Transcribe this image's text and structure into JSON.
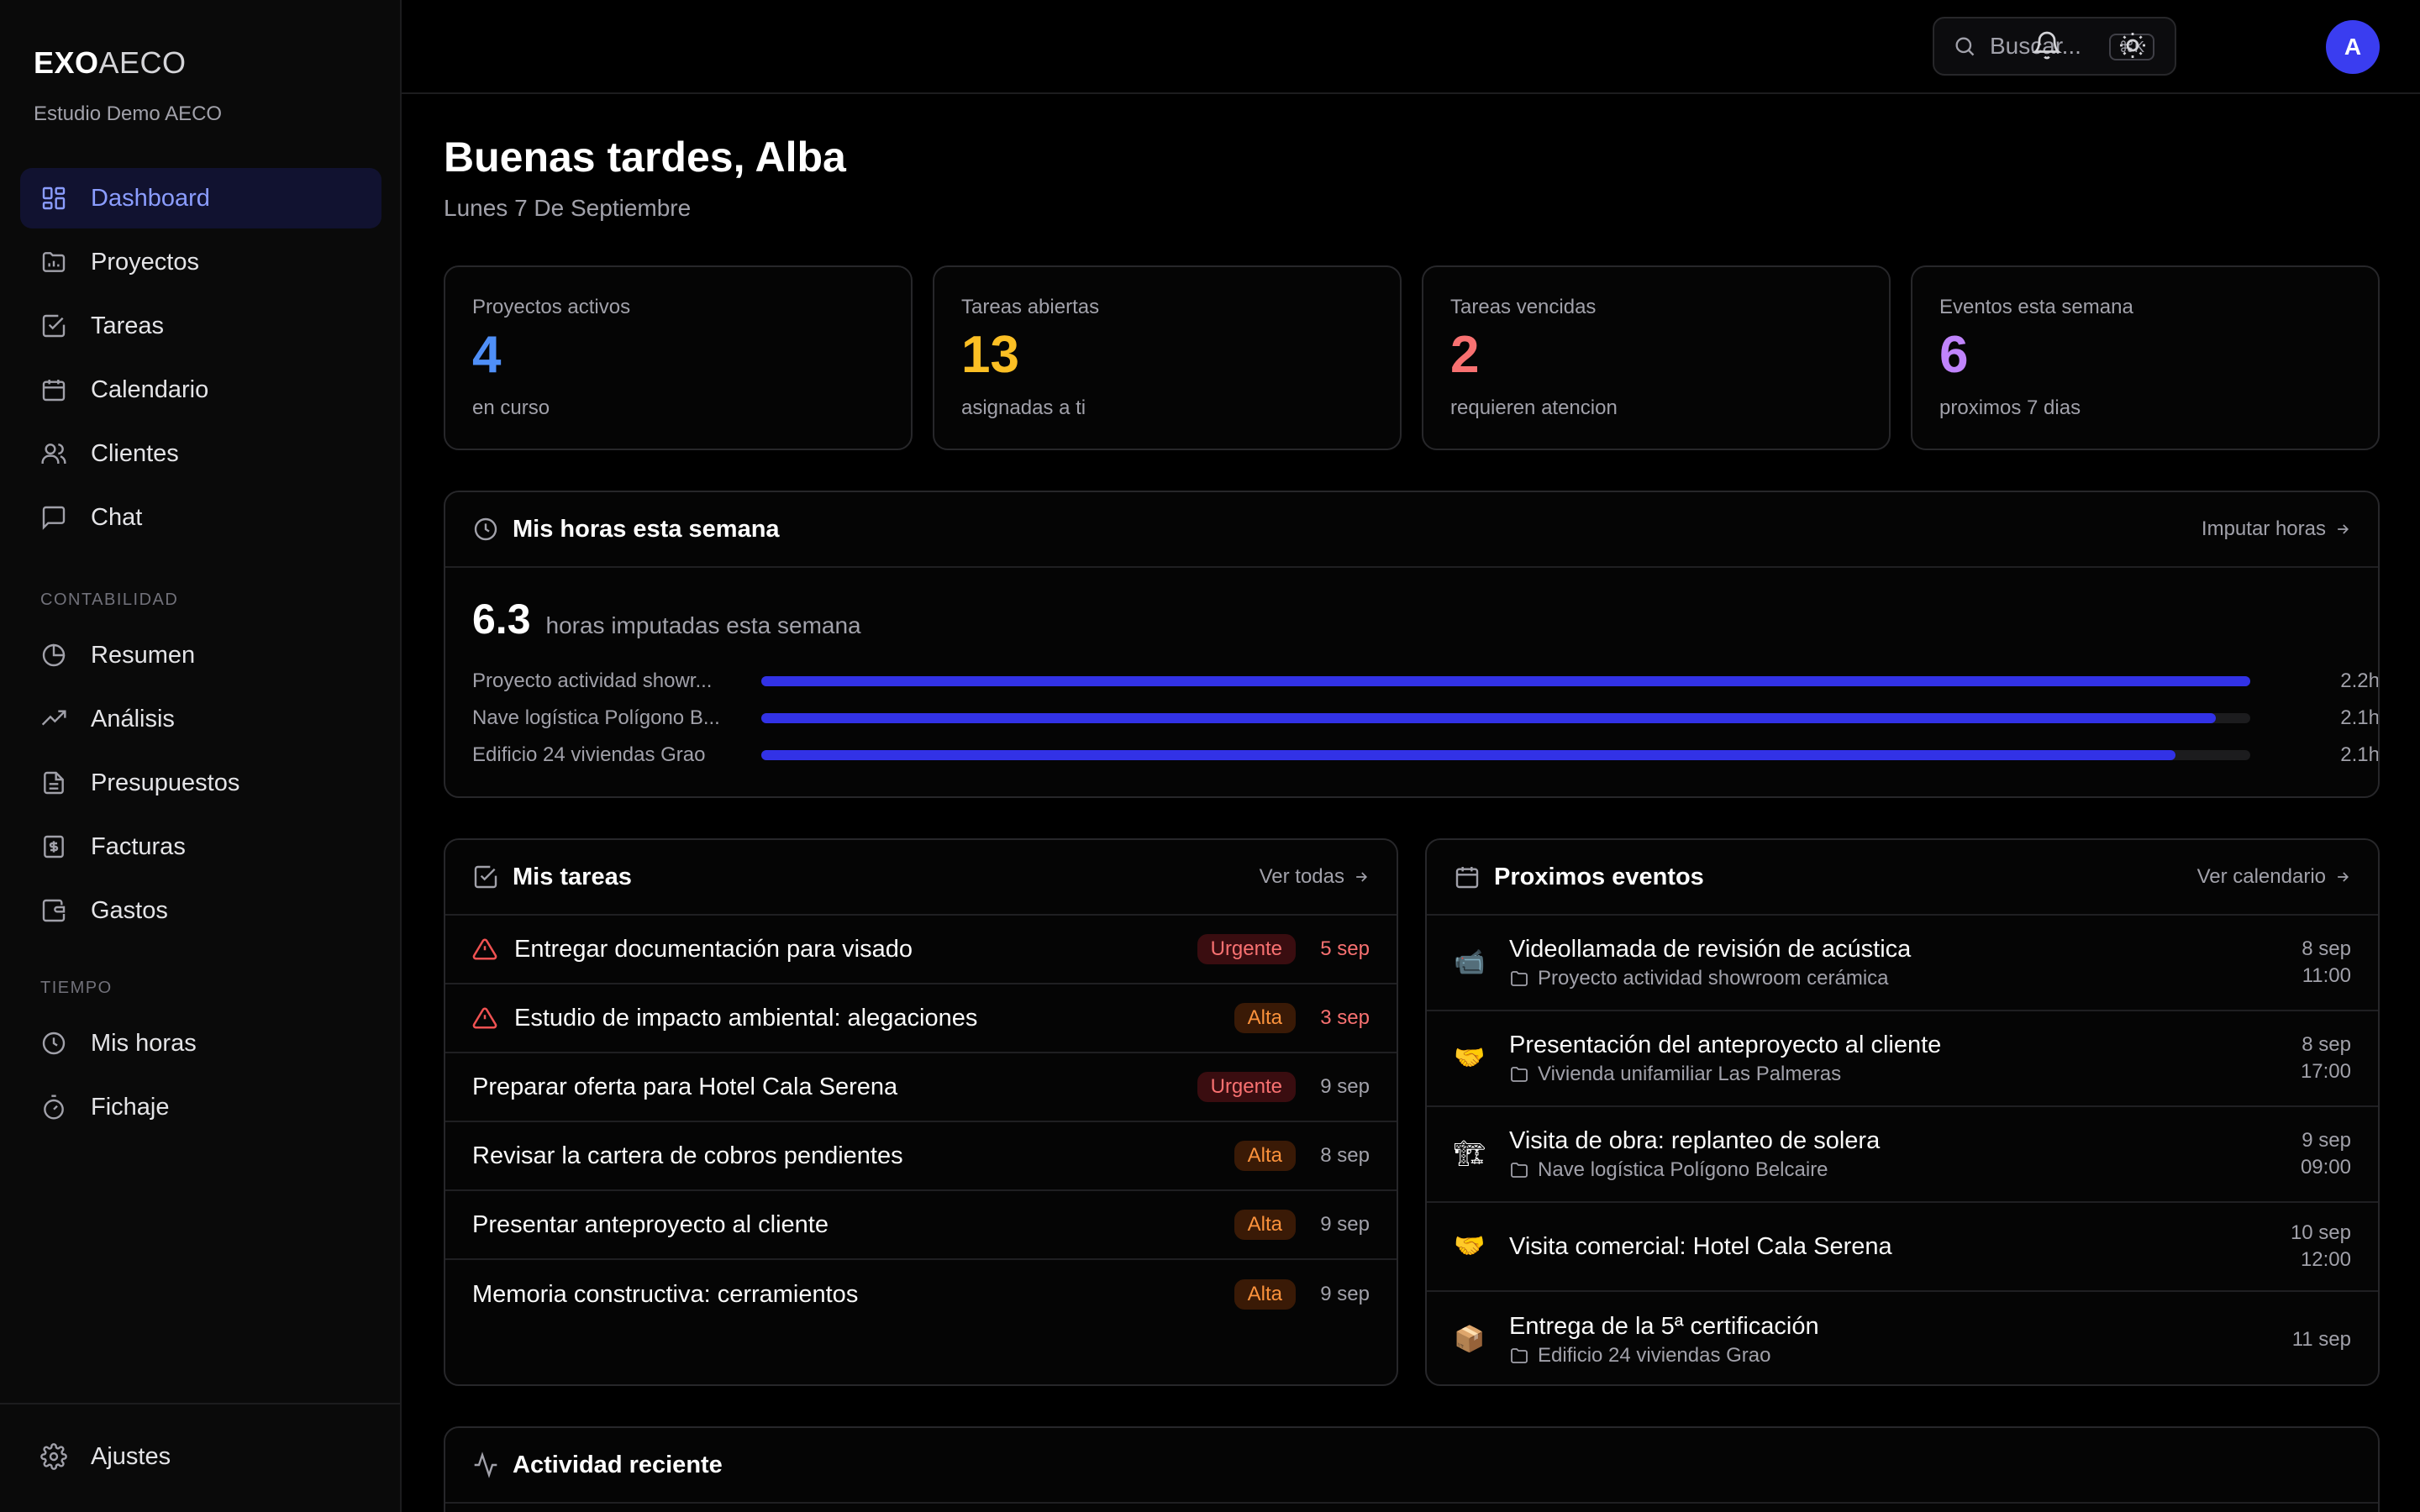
{
  "brand": {
    "bold": "EXO",
    "light": "AECO",
    "org": "Estudio Demo AECO"
  },
  "sidebar": {
    "main_items": [
      {
        "label": "Dashboard",
        "icon": "grid-icon",
        "active": true
      },
      {
        "label": "Proyectos",
        "icon": "folder-icon"
      },
      {
        "label": "Tareas",
        "icon": "checkbox-icon"
      },
      {
        "label": "Calendario",
        "icon": "calendar-icon"
      },
      {
        "label": "Clientes",
        "icon": "users-icon"
      },
      {
        "label": "Chat",
        "icon": "chat-icon"
      }
    ],
    "contabilidad_label": "CONTABILIDAD",
    "contabilidad_items": [
      {
        "label": "Resumen",
        "icon": "pie-chart-icon"
      },
      {
        "label": "Análisis",
        "icon": "trending-icon"
      },
      {
        "label": "Presupuestos",
        "icon": "document-icon"
      },
      {
        "label": "Facturas",
        "icon": "invoice-icon"
      },
      {
        "label": "Gastos",
        "icon": "wallet-icon"
      }
    ],
    "tiempo_label": "TIEMPO",
    "tiempo_items": [
      {
        "label": "Mis horas",
        "icon": "clock-icon"
      },
      {
        "label": "Fichaje",
        "icon": "timer-icon"
      }
    ],
    "settings_label": "Ajustes"
  },
  "topbar": {
    "search_placeholder": "Buscar...",
    "shortcut": "⌘K",
    "avatar_initial": "A"
  },
  "header": {
    "greeting": "Buenas tardes, Alba",
    "date": "Lunes 7 De Septiembre"
  },
  "stats": [
    {
      "label": "Proyectos activos",
      "value": "4",
      "sub": "en curso",
      "color": "#4f8ff7"
    },
    {
      "label": "Tareas abiertas",
      "value": "13",
      "sub": "asignadas a ti",
      "color": "#fbbf24"
    },
    {
      "label": "Tareas vencidas",
      "value": "2",
      "sub": "requieren atencion",
      "color": "#f87171"
    },
    {
      "label": "Eventos esta semana",
      "value": "6",
      "sub": "proximos 7 dias",
      "color": "#c084fc"
    }
  ],
  "hours": {
    "title": "Mis horas esta semana",
    "link": "Imputar horas",
    "total": "6.3",
    "total_label": "horas imputadas esta semana",
    "rows": [
      {
        "project": "Proyecto actividad showr...",
        "hours": "2.2h",
        "fraction": 1.0
      },
      {
        "project": "Nave logística Polígono B...",
        "hours": "2.1h",
        "fraction": 0.977
      },
      {
        "project": "Edificio 24 viviendas Grao",
        "hours": "2.1h",
        "fraction": 0.95
      }
    ]
  },
  "tasks": {
    "title": "Mis tareas",
    "link": "Ver todas",
    "items": [
      {
        "name": "Entregar documentación para visado",
        "priority": "Urgente",
        "due": "5 sep",
        "overdue": true
      },
      {
        "name": "Estudio de impacto ambiental: alegaciones",
        "priority": "Alta",
        "due": "3 sep",
        "overdue": true
      },
      {
        "name": "Preparar oferta para Hotel Cala Serena",
        "priority": "Urgente",
        "due": "9 sep",
        "overdue": false
      },
      {
        "name": "Revisar la cartera de cobros pendientes",
        "priority": "Alta",
        "due": "8 sep",
        "overdue": false
      },
      {
        "name": "Presentar anteproyecto al cliente",
        "priority": "Alta",
        "due": "9 sep",
        "overdue": false
      },
      {
        "name": "Memoria constructiva: cerramientos",
        "priority": "Alta",
        "due": "9 sep",
        "overdue": false
      }
    ]
  },
  "events": {
    "title": "Proximos eventos",
    "link": "Ver calendario",
    "items": [
      {
        "emoji": "📹",
        "title": "Videollamada de revisión de acústica",
        "project": "Proyecto actividad showroom cerámica",
        "day": "8 sep",
        "time": "11:00"
      },
      {
        "emoji": "🤝",
        "title": "Presentación del anteproyecto al cliente",
        "project": "Vivienda unifamiliar Las Palmeras",
        "day": "8 sep",
        "time": "17:00"
      },
      {
        "emoji": "🏗",
        "title": "Visita de obra: replanteo de solera",
        "project": "Nave logística Polígono Belcaire",
        "day": "9 sep",
        "time": "09:00"
      },
      {
        "emoji": "🤝",
        "title": "Visita comercial: Hotel Cala Serena",
        "project": "",
        "day": "10 sep",
        "time": "12:00"
      },
      {
        "emoji": "📦",
        "title": "Entrega de la 5ª certificación",
        "project": "Edificio 24 viviendas Grao",
        "day": "11 sep",
        "time": ""
      }
    ]
  },
  "activity": {
    "title": "Actividad reciente"
  }
}
